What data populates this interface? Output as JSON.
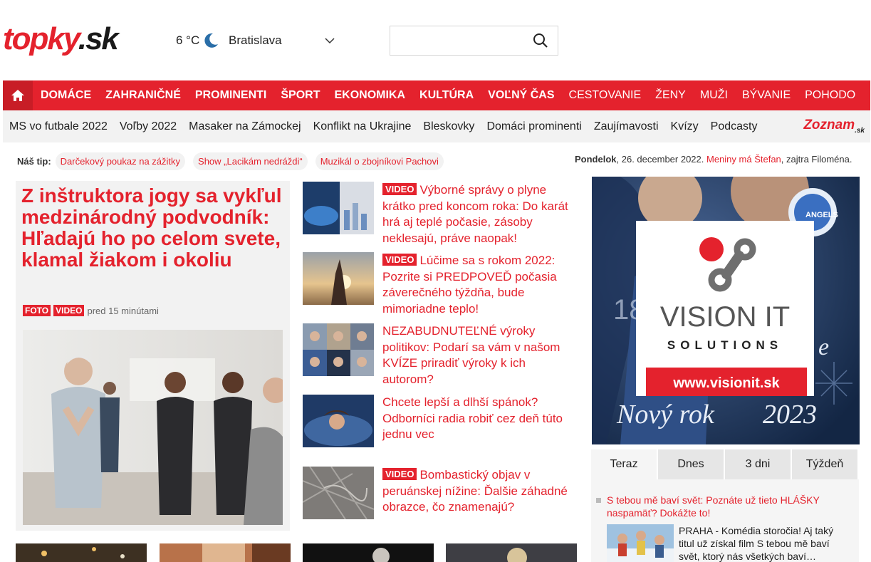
{
  "header": {
    "logo_part1": "topky",
    "logo_part2": ".sk",
    "temperature": "6 °C",
    "city": "Bratislava",
    "search_placeholder": ""
  },
  "main_nav": [
    {
      "label": "DOMÁCE"
    },
    {
      "label": "ZAHRANIČNÉ"
    },
    {
      "label": "PROMINENTI"
    },
    {
      "label": "ŠPORT"
    },
    {
      "label": "EKONOMIKA"
    },
    {
      "label": "KULTÚRA"
    },
    {
      "label": "VOĽNÝ ČAS"
    },
    {
      "label": "CESTOVANIE"
    },
    {
      "label": "ŽENY"
    },
    {
      "label": "MUŽI"
    },
    {
      "label": "BÝVANIE"
    },
    {
      "label": "POHODO"
    }
  ],
  "sub_nav": [
    {
      "label": "MS vo futbale 2022"
    },
    {
      "label": "Voľby 2022"
    },
    {
      "label": "Masaker na Zámockej"
    },
    {
      "label": "Konflikt na Ukrajine"
    },
    {
      "label": "Bleskovky"
    },
    {
      "label": "Domáci prominenti"
    },
    {
      "label": "Zaujímavosti"
    },
    {
      "label": "Kvízy"
    },
    {
      "label": "Podcasty"
    }
  ],
  "zoznam": {
    "brand": "Zoznam",
    "suffix": ".sk"
  },
  "tips": {
    "label": "Náš tip:",
    "items": [
      {
        "label": "Darčekový poukaz na zážitky"
      },
      {
        "label": "Show „Lacikám nedráždi“"
      },
      {
        "label": "Muzikál o zbojníkovi Pachovi"
      }
    ]
  },
  "dateline": {
    "day": "Pondelok",
    "date": ", 26. december 2022.",
    "nameday": "Meniny má Štefan",
    "tomorrow": ", zajtra Filoména."
  },
  "lead": {
    "title": "Z inštruktora jogy sa vykľul medzinárodný podvodník: Hľadajú ho po celom svete, klamal žiakom i okoliu",
    "badges": [
      "FOTO",
      "VIDEO"
    ],
    "time": "pred 15 minútami"
  },
  "side_articles": [
    {
      "badge": "VIDEO",
      "title": "Výborné správy o plyne krátko pred koncom roka: Do karát hrá aj teplé počasie, zásoby neklesajú, práve naopak!"
    },
    {
      "badge": "VIDEO",
      "title": "Lúčime sa s rokom 2022: Pozrite si PREDPOVEĎ počasia záverečného týždňa, bude mimoriadne teplo!"
    },
    {
      "badge": "",
      "title": "NEZABUDNUTEĽNÉ výroky politikov: Podarí sa vám v našom KVÍZE priradiť výroky k ich autorom?"
    },
    {
      "badge": "",
      "title": "Chcete lepší a dlhší spánok? Odborníci radia robiť cez deň túto jednu vec"
    },
    {
      "badge": "VIDEO",
      "title": "Bombastický objav v peruánskej nížine: Ďalšie záhadné obrazce, čo znamenajú?"
    }
  ],
  "ad": {
    "brand_line1": "VISION IT",
    "brand_line2": "SOLUTIONS",
    "url": "www.visionit.sk",
    "greeting": "Nový rok",
    "year": "2023",
    "badge_text": "ANGELS",
    "jersey": "18",
    "hidden_text": "e"
  },
  "tabs": [
    {
      "label": "Teraz"
    },
    {
      "label": "Dnes"
    },
    {
      "label": "3 dni"
    },
    {
      "label": "Týždeň"
    }
  ],
  "tab_panel": {
    "title": "S tebou mě baví svět: Poznáte už tieto HLÁŠKY naspamäť? Dokážte to!",
    "text": "PRAHA - Komédia storočia! Aj taký titul už získal film S tebou mě baví svět, ktorý nás všetkých baví…"
  },
  "colors": {
    "accent": "#e4222d",
    "nav_gray": "#f2f2f2"
  }
}
